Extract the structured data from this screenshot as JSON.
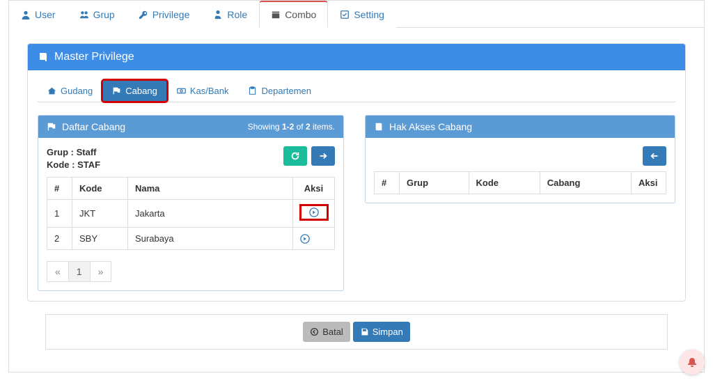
{
  "topTabs": {
    "user": "User",
    "grup": "Grup",
    "privilege": "Privilege",
    "role": "Role",
    "combo": "Combo",
    "setting": "Setting"
  },
  "panelTitle": "Master Privilege",
  "subTabs": {
    "gudang": "Gudang",
    "cabang": "Cabang",
    "kasbank": "Kas/Bank",
    "departemen": "Departemen"
  },
  "left": {
    "title": "Daftar Cabang",
    "showing_pre": "Showing ",
    "showing_range": "1-2",
    "showing_mid": " of ",
    "showing_total": "2",
    "showing_post": " items.",
    "grup_label": "Grup : ",
    "grup_value": "Staff",
    "kode_label": "Kode : ",
    "kode_value": "STAF",
    "cols": {
      "no": "#",
      "kode": "Kode",
      "nama": "Nama",
      "aksi": "Aksi"
    },
    "rows": [
      {
        "no": "1",
        "kode": "JKT",
        "nama": "Jakarta"
      },
      {
        "no": "2",
        "kode": "SBY",
        "nama": "Surabaya"
      }
    ],
    "pager": {
      "prev": "«",
      "page": "1",
      "next": "»"
    }
  },
  "right": {
    "title": "Hak Akses Cabang",
    "cols": {
      "no": "#",
      "grup": "Grup",
      "kode": "Kode",
      "cabang": "Cabang",
      "aksi": "Aksi"
    }
  },
  "footer": {
    "batal": "Batal",
    "simpan": "Simpan"
  }
}
